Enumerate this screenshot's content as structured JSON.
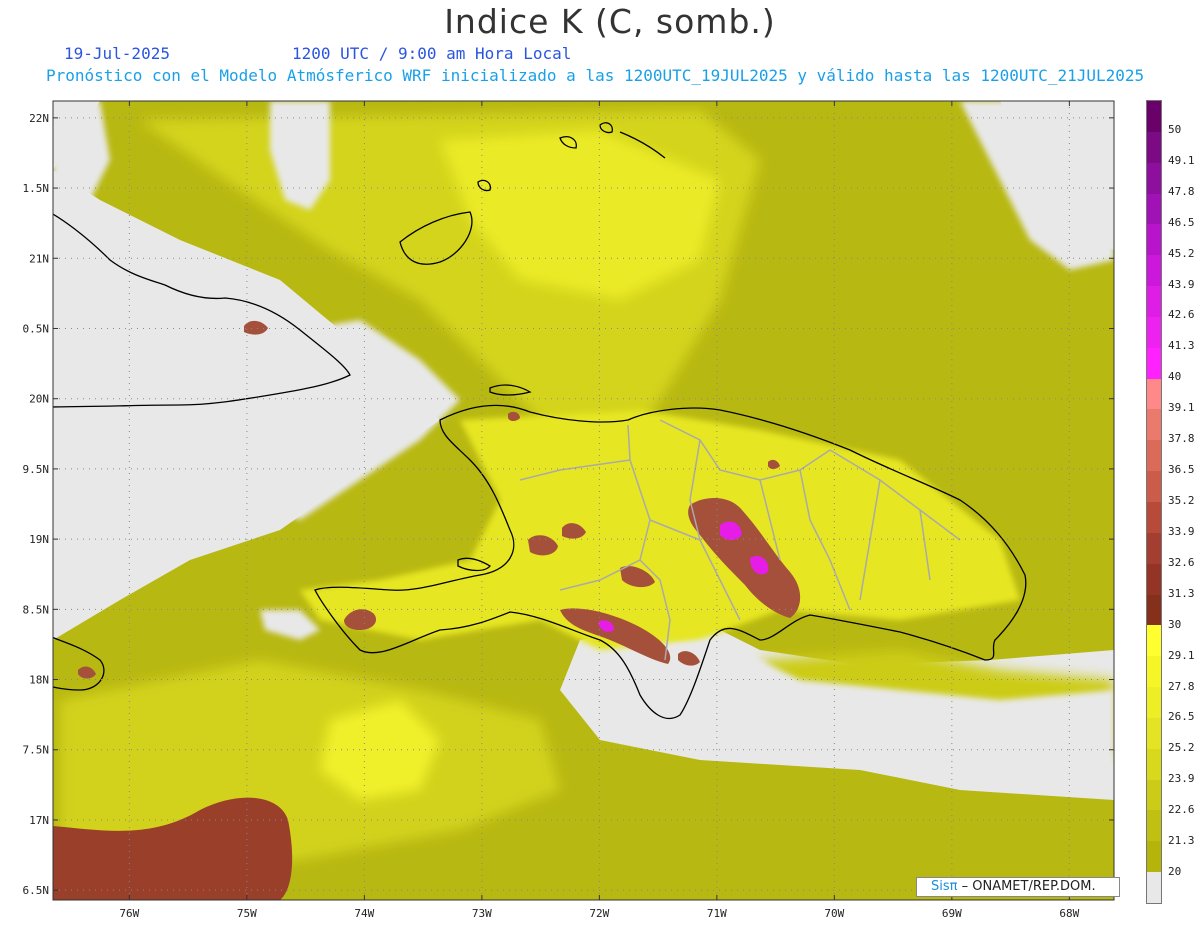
{
  "header": {
    "title": "Indice K (C, somb.)",
    "date": "19-Jul-2025",
    "time": "1200 UTC / 9:00 am Hora Local",
    "forecast": "Pronóstico con el Modelo Atmósferico WRF inicializado a las 1200UTC_19JUL2025 y válido hasta las  1200UTC_21JUL2025"
  },
  "axes": {
    "lat_labels": [
      "22N",
      "1.5N",
      "21N",
      "0.5N",
      "20N",
      "9.5N",
      "19N",
      "8.5N",
      "18N",
      "7.5N",
      "17N",
      "6.5N"
    ],
    "lat_values": [
      22,
      21.5,
      21,
      20.5,
      20,
      19.5,
      19,
      18.5,
      18,
      17.5,
      17,
      16.5
    ],
    "lon_labels": [
      "76W",
      "75W",
      "74W",
      "73W",
      "72W",
      "71W",
      "70W",
      "69W",
      "68W"
    ],
    "lon_values": [
      -76,
      -75,
      -74,
      -73,
      -72,
      -71,
      -70,
      -69,
      -68
    ],
    "lat_range": [
      16.43,
      22.12
    ],
    "lon_range": [
      -76.65,
      -67.62
    ]
  },
  "colorbar": {
    "labels": [
      "50",
      "49.1",
      "47.8",
      "46.5",
      "45.2",
      "43.9",
      "42.6",
      "41.3",
      "40",
      "39.1",
      "37.8",
      "36.5",
      "35.2",
      "33.9",
      "32.6",
      "31.3",
      "30",
      "29.1",
      "27.8",
      "26.5",
      "25.2",
      "23.9",
      "22.6",
      "21.3",
      "20"
    ],
    "colors": [
      "#6a006a",
      "#7c0a84",
      "#8e0e9e",
      "#a012b6",
      "#b814cc",
      "#cc18dc",
      "#de1ee6",
      "#ee22f0",
      "#ff22ff",
      "#ff8888",
      "#ea7a6c",
      "#dc6a58",
      "#cc5c4a",
      "#b84a3a",
      "#a43e30",
      "#943426",
      "#84301a",
      "#ffff30",
      "#f6f626",
      "#eeee24",
      "#e4e424",
      "#d8d81c",
      "#cccc18",
      "#c0c012",
      "#b4b40a",
      "#e8e8e8"
    ],
    "units": "C"
  },
  "map": {
    "background_color": "#e8e8e8",
    "field_color": "#b8b812",
    "coastline_color": "#000000",
    "border_color": "#aaaaaa"
  },
  "credits": {
    "logo": "Sisπ",
    "text": "– ONAMET/REP.DOM."
  }
}
